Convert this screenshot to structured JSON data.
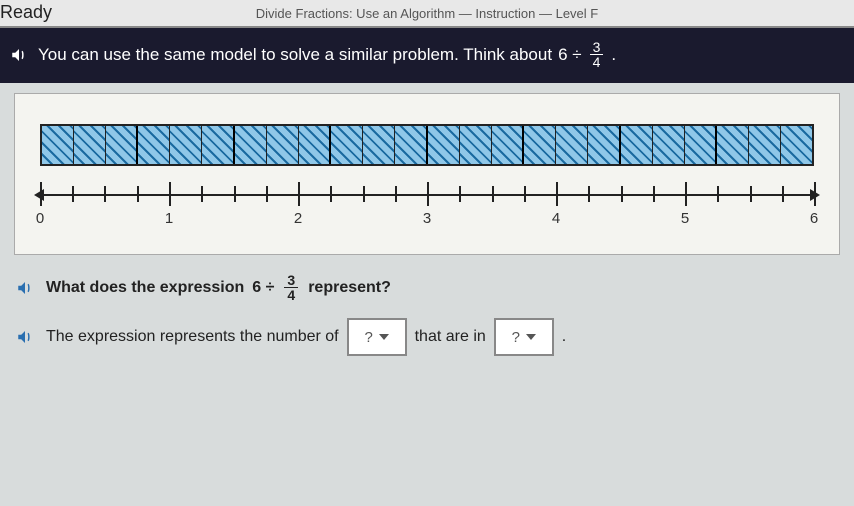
{
  "header": {
    "brand": "Ready",
    "lesson": "Divide Fractions: Use an Algorithm — Instruction — Level F"
  },
  "prompt": {
    "lead": "You can use the same model to solve a similar problem. Think about",
    "expr_left": "6 ÷",
    "frac_num": "3",
    "frac_den": "4",
    "tail": "."
  },
  "model": {
    "cells": 24,
    "group_size": 3,
    "ticks": {
      "minor": 24,
      "majors": [
        0,
        1,
        2,
        3,
        4,
        5,
        6
      ]
    }
  },
  "q1": {
    "lead": "What does the expression",
    "expr_left": "6 ÷",
    "frac_num": "3",
    "frac_den": "4",
    "tail": "represent?"
  },
  "q2": {
    "lead": "The expression represents the number of",
    "mid": "that are in",
    "tail": ".",
    "dropdown_placeholder": "?"
  }
}
